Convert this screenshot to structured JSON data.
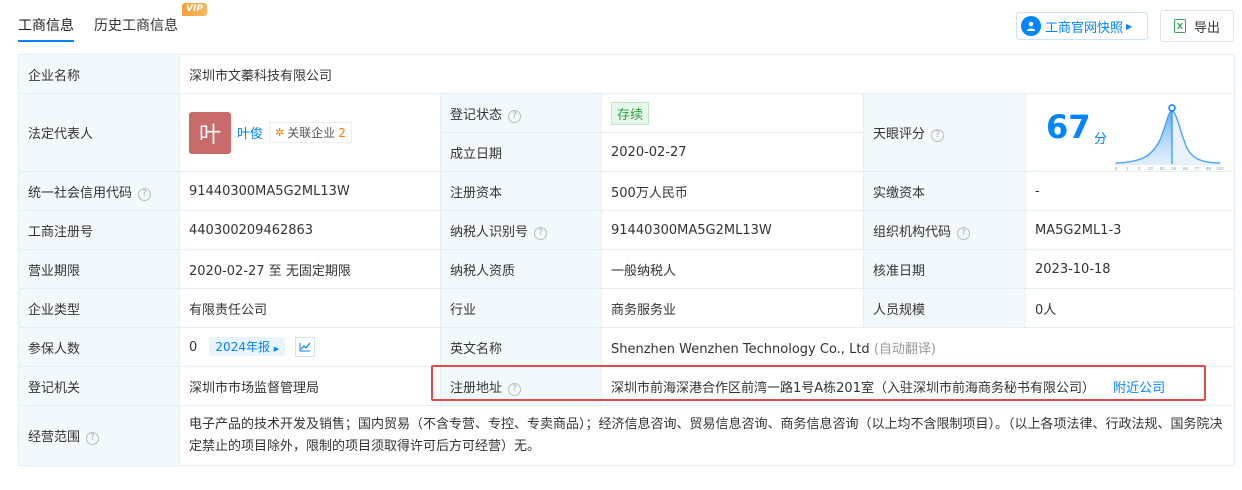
{
  "tabs": [
    {
      "label": "工商信息",
      "active": true
    },
    {
      "label": "历史工商信息",
      "badge": "VIP"
    }
  ],
  "toolbar": {
    "snapshot_label": "工商官网快照",
    "export_label": "导出",
    "xls_icon_text": "X"
  },
  "info": {
    "company_name_label": "企业名称",
    "company_name": "深圳市文蓁科技有限公司",
    "legal_rep_label": "法定代表人",
    "legal_rep_avatar": "叶",
    "legal_rep_name": "叶俊",
    "related_label": "关联企业",
    "related_count": "2",
    "reg_status_label": "登记状态",
    "reg_status": "存续",
    "established_label": "成立日期",
    "established": "2020-02-27",
    "rating_label": "天眼评分",
    "rating_score": "67",
    "rating_unit": "分",
    "credit_code_label": "统一社会信用代码",
    "credit_code": "91440300MA5G2ML13W",
    "reg_capital_label": "注册资本",
    "reg_capital": "500万人民币",
    "paid_capital_label": "实缴资本",
    "paid_capital": "-",
    "reg_no_label": "工商注册号",
    "reg_no": "440300209462863",
    "taxpayer_id_label": "纳税人识别号",
    "taxpayer_id": "91440300MA5G2ML13W",
    "org_code_label": "组织机构代码",
    "org_code": "MA5G2ML1-3",
    "term_label": "营业期限",
    "term": "2020-02-27 至 无固定期限",
    "taxpayer_qual_label": "纳税人资质",
    "taxpayer_qual": "一般纳税人",
    "approve_date_label": "核准日期",
    "approve_date": "2023-10-18",
    "company_type_label": "企业类型",
    "company_type": "有限责任公司",
    "industry_label": "行业",
    "industry": "商务服务业",
    "staff_size_label": "人员规模",
    "staff_size": "0人",
    "insured_label": "参保人数",
    "insured": "0",
    "insured_year": "2024年报",
    "english_name_label": "英文名称",
    "english_name": "Shenzhen Wenzhen Technology Co., Ltd",
    "auto_translate": "(自动翻译)",
    "authority_label": "登记机关",
    "authority": "深圳市市场监督管理局",
    "address_label": "注册地址",
    "address": "深圳市前海深港合作区前湾一路1号A栋201室（入驻深圳市前海商务秘书有限公司）",
    "nearby_link": "附近公司",
    "scope_label": "经营范围",
    "scope": "电子产品的技术开发及销售；国内贸易（不含专营、专控、专卖商品）；经济信息咨询、贸易信息咨询、商务信息咨询（以上均不含限制项目）。（以上各项法律、行政法规、国务院决定禁止的项目除外，限制的项目须取得许可后方可经营）无。"
  },
  "rating_axis": [
    "0",
    "1",
    "3",
    "10",
    "50",
    "55",
    "66",
    "77",
    "99",
    "100"
  ],
  "colors": {
    "accent": "#0084ff",
    "highlight_border": "#e04b4b",
    "status_green": "#2f9e44"
  }
}
